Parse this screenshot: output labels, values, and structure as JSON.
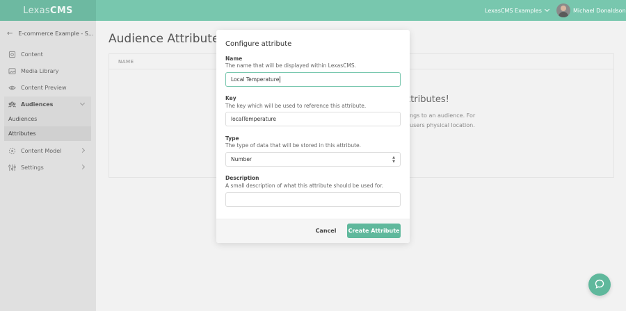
{
  "brand": {
    "logo_part1": "Lexas",
    "logo_part2": "CMS",
    "accent": "#78c7ae",
    "button_color": "#5fb89c"
  },
  "topbar": {
    "org_name": "LexasCMS Examples",
    "user_name": "Michael Donaldson"
  },
  "sidebar": {
    "back_label": "E-commerce Example - S...",
    "items": [
      {
        "label": "Content",
        "icon": "content-icon"
      },
      {
        "label": "Media Library",
        "icon": "image-icon"
      },
      {
        "label": "Content Preview",
        "icon": "eye-icon"
      },
      {
        "label": "Audiences",
        "icon": "audiences-icon"
      },
      {
        "label": "Content Model",
        "icon": "content-model-icon"
      },
      {
        "label": "Settings",
        "icon": "settings-icon"
      }
    ],
    "audiences_sub": [
      "Audiences",
      "Attributes"
    ]
  },
  "main": {
    "title": "Audience Attributes",
    "table_header": "NAME",
    "empty_title": "e attributes!",
    "empty_text1": "elongs to an audience. For",
    "empty_text2": "users physical location."
  },
  "modal": {
    "title": "Configure attribute",
    "name_label": "Name",
    "name_help": "The name that will be displayed within LexasCMS.",
    "name_value": "Local Temperature",
    "key_label": "Key",
    "key_help": "The key which will be used to reference this attribute.",
    "key_value": "localTemperature",
    "type_label": "Type",
    "type_help": "The type of data that will be stored in this attribute.",
    "type_value": "Number",
    "desc_label": "Description",
    "desc_help": "A small description of what this attribute should be used for.",
    "desc_value": "",
    "cancel_label": "Cancel",
    "create_label": "Create Attribute"
  }
}
